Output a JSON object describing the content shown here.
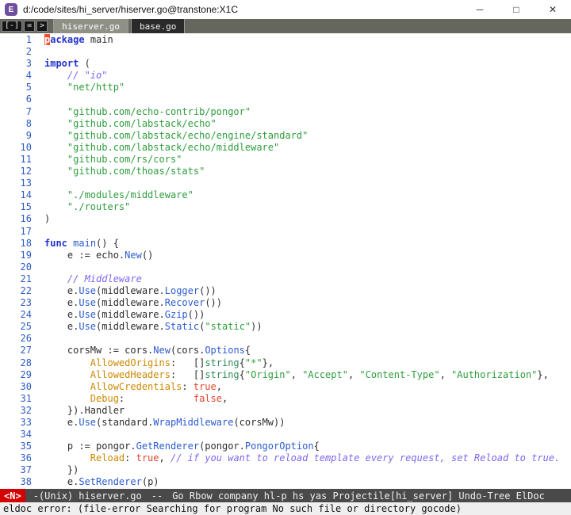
{
  "palette": {
    "keyword": "#2233cc",
    "function": "#2b5bd0",
    "string": "#2e9e3c",
    "comment": "#7b68ee",
    "field": "#cc8800",
    "constant": "#e04428",
    "type": "#2e8b57",
    "text": "#2d2d2d",
    "linenum": "#2d5bc4",
    "cursor": "#f1502f",
    "modeline-bg": "#4a4a4a",
    "evil": "#d40000",
    "tabbar-bg": "#65675e",
    "tab-active": "#8f9186",
    "tab-inactive": "#2a2a2a",
    "echo-bg": "#efefef"
  },
  "titlebar": {
    "title": "d:/code/sites/hi_server/hiserver.go@transtone:X1C",
    "controls": {
      "minimize": "─",
      "maximize": "□",
      "close": "✕"
    }
  },
  "tabbar": {
    "buttons": [
      {
        "name": "tabbar-home-button",
        "label": "[-]"
      },
      {
        "name": "tabbar-scroll-left-button",
        "label": "="
      },
      {
        "name": "tabbar-scroll-right-button",
        "label": ">"
      }
    ],
    "tabs": [
      {
        "label": "hiserver.go",
        "active": true
      },
      {
        "label": "base.go",
        "active": false
      }
    ]
  },
  "editor": {
    "lines": [
      {
        "n": 1,
        "t": [
          [
            "cursor",
            "p"
          ],
          [
            "kw",
            "ackage"
          ],
          [
            "plain",
            " main"
          ]
        ]
      },
      {
        "n": 2,
        "t": []
      },
      {
        "n": 3,
        "t": [
          [
            "kw",
            "import"
          ],
          [
            "plain",
            " ("
          ]
        ]
      },
      {
        "n": 4,
        "t": [
          [
            "cmt",
            "    // \"io\""
          ]
        ]
      },
      {
        "n": 5,
        "t": [
          [
            "plain",
            "    "
          ],
          [
            "str",
            "\"net/http\""
          ]
        ]
      },
      {
        "n": 6,
        "t": []
      },
      {
        "n": 7,
        "t": [
          [
            "plain",
            "    "
          ],
          [
            "str",
            "\"github.com/echo-contrib/pongor\""
          ]
        ]
      },
      {
        "n": 8,
        "t": [
          [
            "plain",
            "    "
          ],
          [
            "str",
            "\"github.com/labstack/echo\""
          ]
        ]
      },
      {
        "n": 9,
        "t": [
          [
            "plain",
            "    "
          ],
          [
            "str",
            "\"github.com/labstack/echo/engine/standard\""
          ]
        ]
      },
      {
        "n": 10,
        "t": [
          [
            "plain",
            "    "
          ],
          [
            "str",
            "\"github.com/labstack/echo/middleware\""
          ]
        ]
      },
      {
        "n": 11,
        "t": [
          [
            "plain",
            "    "
          ],
          [
            "str",
            "\"github.com/rs/cors\""
          ]
        ]
      },
      {
        "n": 12,
        "t": [
          [
            "plain",
            "    "
          ],
          [
            "str",
            "\"github.com/thoas/stats\""
          ]
        ]
      },
      {
        "n": 13,
        "t": []
      },
      {
        "n": 14,
        "t": [
          [
            "plain",
            "    "
          ],
          [
            "str",
            "\"./modules/middleware\""
          ]
        ]
      },
      {
        "n": 15,
        "t": [
          [
            "plain",
            "    "
          ],
          [
            "str",
            "\"./routers\""
          ]
        ]
      },
      {
        "n": 16,
        "t": [
          [
            "plain",
            ")"
          ]
        ]
      },
      {
        "n": 17,
        "t": []
      },
      {
        "n": 18,
        "t": [
          [
            "kw",
            "func"
          ],
          [
            "plain",
            " "
          ],
          [
            "fn",
            "main"
          ],
          [
            "plain",
            "() {"
          ]
        ]
      },
      {
        "n": 19,
        "t": [
          [
            "plain",
            "    e := echo."
          ],
          [
            "fn",
            "New"
          ],
          [
            "plain",
            "()"
          ]
        ]
      },
      {
        "n": 20,
        "t": []
      },
      {
        "n": 21,
        "t": [
          [
            "cmt",
            "    // Middleware"
          ]
        ]
      },
      {
        "n": 22,
        "t": [
          [
            "plain",
            "    e."
          ],
          [
            "fn",
            "Use"
          ],
          [
            "plain",
            "(middleware."
          ],
          [
            "fn",
            "Logger"
          ],
          [
            "plain",
            "())"
          ]
        ]
      },
      {
        "n": 23,
        "t": [
          [
            "plain",
            "    e."
          ],
          [
            "fn",
            "Use"
          ],
          [
            "plain",
            "(middleware."
          ],
          [
            "fn",
            "Recover"
          ],
          [
            "plain",
            "())"
          ]
        ]
      },
      {
        "n": 24,
        "t": [
          [
            "plain",
            "    e."
          ],
          [
            "fn",
            "Use"
          ],
          [
            "plain",
            "(middleware."
          ],
          [
            "fn",
            "Gzip"
          ],
          [
            "plain",
            "())"
          ]
        ]
      },
      {
        "n": 25,
        "t": [
          [
            "plain",
            "    e."
          ],
          [
            "fn",
            "Use"
          ],
          [
            "plain",
            "(middleware."
          ],
          [
            "fn",
            "Static"
          ],
          [
            "plain",
            "("
          ],
          [
            "str",
            "\"static\""
          ],
          [
            "plain",
            "))"
          ]
        ]
      },
      {
        "n": 26,
        "t": []
      },
      {
        "n": 27,
        "t": [
          [
            "plain",
            "    corsMw := cors."
          ],
          [
            "fn",
            "New"
          ],
          [
            "plain",
            "(cors."
          ],
          [
            "fn",
            "Options"
          ],
          [
            "plain",
            "{"
          ]
        ]
      },
      {
        "n": 28,
        "t": [
          [
            "plain",
            "        "
          ],
          [
            "field",
            "AllowedOrigins"
          ],
          [
            "plain",
            ":   []"
          ],
          [
            "type",
            "string"
          ],
          [
            "plain",
            "{"
          ],
          [
            "str",
            "\"*\""
          ],
          [
            "plain",
            "},"
          ]
        ]
      },
      {
        "n": 29,
        "t": [
          [
            "plain",
            "        "
          ],
          [
            "field",
            "AllowedHeaders"
          ],
          [
            "plain",
            ":   []"
          ],
          [
            "type",
            "string"
          ],
          [
            "plain",
            "{"
          ],
          [
            "str",
            "\"Origin\""
          ],
          [
            "plain",
            ", "
          ],
          [
            "str",
            "\"Accept\""
          ],
          [
            "plain",
            ", "
          ],
          [
            "str",
            "\"Content-Type\""
          ],
          [
            "plain",
            ", "
          ],
          [
            "str",
            "\"Authorization\""
          ],
          [
            "plain",
            "},"
          ]
        ]
      },
      {
        "n": 30,
        "t": [
          [
            "plain",
            "        "
          ],
          [
            "field",
            "AllowCredentials"
          ],
          [
            "plain",
            ": "
          ],
          [
            "const",
            "true"
          ],
          [
            "plain",
            ","
          ]
        ]
      },
      {
        "n": 31,
        "t": [
          [
            "plain",
            "        "
          ],
          [
            "field",
            "Debug"
          ],
          [
            "plain",
            ":            "
          ],
          [
            "const",
            "false"
          ],
          [
            "plain",
            ","
          ]
        ]
      },
      {
        "n": 32,
        "t": [
          [
            "plain",
            "    }).Handler"
          ]
        ]
      },
      {
        "n": 33,
        "t": [
          [
            "plain",
            "    e."
          ],
          [
            "fn",
            "Use"
          ],
          [
            "plain",
            "(standard."
          ],
          [
            "fn",
            "WrapMiddleware"
          ],
          [
            "plain",
            "(corsMw))"
          ]
        ]
      },
      {
        "n": 34,
        "t": []
      },
      {
        "n": 35,
        "t": [
          [
            "plain",
            "    p := pongor."
          ],
          [
            "fn",
            "GetRenderer"
          ],
          [
            "plain",
            "(pongor."
          ],
          [
            "fn",
            "PongorOption"
          ],
          [
            "plain",
            "{"
          ]
        ]
      },
      {
        "n": 36,
        "t": [
          [
            "plain",
            "        "
          ],
          [
            "field",
            "Reload"
          ],
          [
            "plain",
            ": "
          ],
          [
            "const",
            "true"
          ],
          [
            "plain",
            ", "
          ],
          [
            "cmt",
            "// if you want to reload template every request, set Reload to true."
          ]
        ]
      },
      {
        "n": 37,
        "t": [
          [
            "plain",
            "    })"
          ]
        ]
      },
      {
        "n": 38,
        "t": [
          [
            "plain",
            "    e."
          ],
          [
            "fn",
            "SetRenderer"
          ],
          [
            "plain",
            "(p)"
          ]
        ]
      }
    ]
  },
  "modeline": {
    "state": "<N>",
    "encoding": "-(Unix)",
    "buffer": "hiserver.go",
    "separator": "--",
    "modes": "Go Rbow company hl-p hs yas Projectile[hi_server] Undo-Tree ElDoc"
  },
  "echo": {
    "message": "eldoc error: (file-error Searching for program No such file or directory gocode)"
  }
}
